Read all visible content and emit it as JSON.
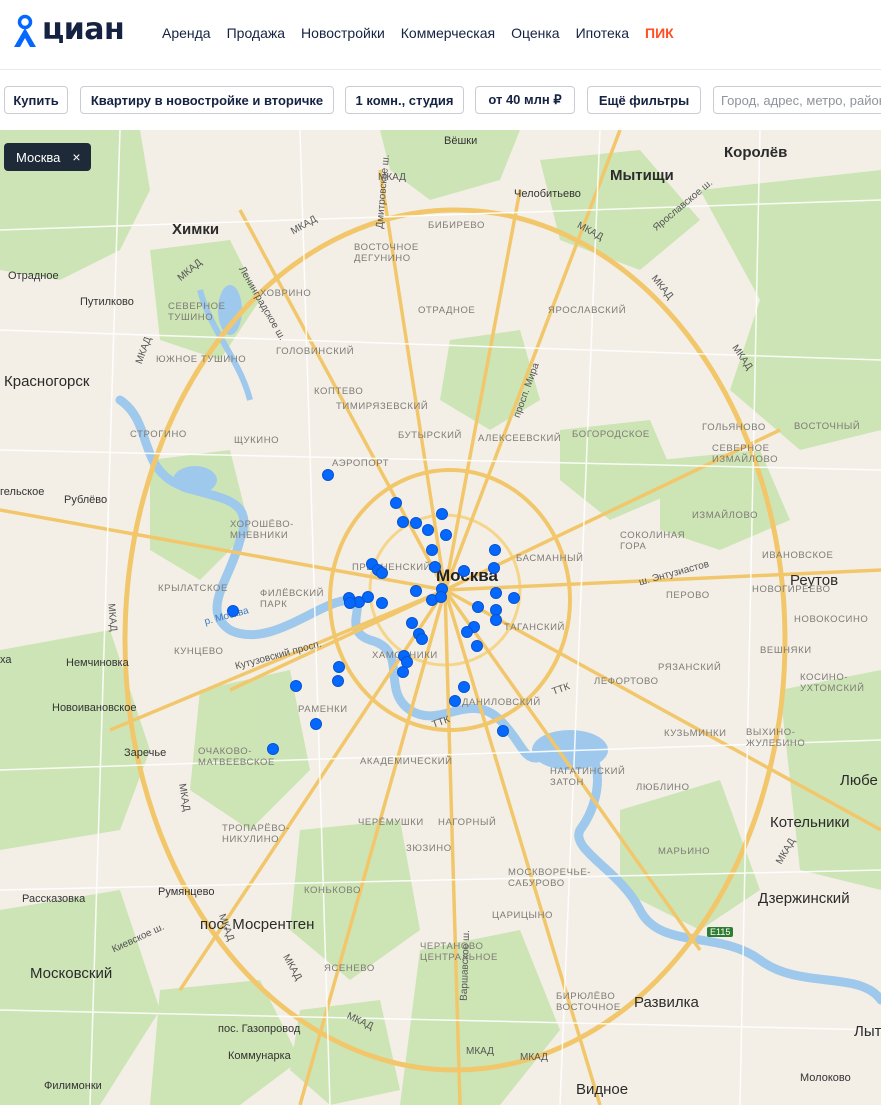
{
  "logo": {
    "text": "циан"
  },
  "nav": {
    "items": [
      "Аренда",
      "Продажа",
      "Новостройки",
      "Коммерческая",
      "Оценка",
      "Ипотека",
      "ПИК"
    ]
  },
  "filters": {
    "deal": "Купить",
    "object": "Квартиру в новостройке и вторичке",
    "rooms": "1 комн., студия",
    "price": "от 40 млн ₽",
    "more": "Ещё фильтры",
    "search_placeholder": "Город, адрес, метро, район"
  },
  "map": {
    "region_chip": "Москва",
    "center_label": "Москва",
    "cities": [
      "Химки",
      "Мытищи",
      "Королёв",
      "Красногорск",
      "Реутов",
      "Любе",
      "Котельники",
      "Дзержинский",
      "Развилка",
      "Видное",
      "Московский",
      "пос. Мосрентген",
      "Лыт"
    ],
    "towns": [
      "Вёшки",
      "Челобитьево",
      "Отрадное",
      "Путилково",
      "Рублёво",
      "Немчиновка",
      "Новоивановское",
      "Заречье",
      "Румянцево",
      "Рассказовка",
      "пос. Газопровод",
      "Коммунарка",
      "Филимонки",
      "Молоково",
      "гельское",
      "ха"
    ],
    "districts": [
      "БИБИРЕВО",
      "ВОСТОЧНОЕ ДЕГУНИНО",
      "ХОВРИНО",
      "СЕВЕРНОЕ ТУШИНО",
      "ОТРАДНОЕ",
      "ЯРОСЛАВСКИЙ",
      "ГОЛОВИНСКИЙ",
      "ЮЖНОЕ ТУШИНО",
      "КОПТЕВО",
      "ТИМИРЯЗЕВСКИЙ",
      "БУТЫРСКИЙ",
      "АЛЕКСЕЕВСКИЙ",
      "БОГОРОДСКОЕ",
      "ГОЛЬЯНОВО",
      "ВОСТОЧНЫЙ",
      "СЕВЕРНОЕ ИЗМАЙЛОВО",
      "СТРОГИНО",
      "ЩУКИНО",
      "АЭРОПОРТ",
      "ИЗМАЙЛОВО",
      "ХОРОШЁВО-МНЕВНИКИ",
      "БАСМАННЫЙ",
      "СОКОЛИНАЯ ГОРА",
      "ИВАНОВСКОЕ",
      "КРЫЛАТСКОЕ",
      "ФИЛЁВСКИЙ ПАРК",
      "ПРЕСНЕНСКИЙ",
      "ПЕРОВО",
      "НОВОГИРЕЕВО",
      "ТАГАНСКИЙ",
      "НОВОКОСИНО",
      "КУНЦЕВО",
      "ХАМОВНИКИ",
      "ВЕШНЯКИ",
      "РЯЗАНСКИЙ",
      "КОСИНО-УХТОМСКИЙ",
      "РАМЕНКИ",
      "ДАНИЛОВСКИЙ",
      "КУЗЬМИНКИ",
      "ЛЕФОРТОВО",
      "ВЫХИНО-ЖУЛЕБИНО",
      "ОЧАКОВО-МАТВЕЕВСКОЕ",
      "АКАДЕМИЧЕСКИЙ",
      "НАГАТИНСКИЙ ЗАТОН",
      "ЛЮБЛИНО",
      "ТРОПАРЁВО-НИКУЛИНО",
      "ЧЕРЁМУШКИ",
      "НАГОРНЫЙ",
      "МАРЬИНО",
      "ЗЮЗИНО",
      "МОСКВОРЕЧЬЕ-САБУРОВО",
      "КОНЬКОВО",
      "ЦАРИЦЫНО",
      "ЧЕРТАНОВО ЦЕНТРАЛЬНОЕ",
      "ЯСЕНЕВО",
      "БИРЮЛЁВО ВОСТОЧНОЕ"
    ],
    "roads": [
      "МКАД",
      "Дмитровское ш.",
      "Ленинградское ш.",
      "Ярославское ш.",
      "просп. Мира",
      "ТТК",
      "ш. Энтузиастов",
      "Кутузовский просп.",
      "Варшавское ш.",
      "Киевское ш.",
      "р. Москва",
      "E115"
    ],
    "listings_count": 58
  }
}
